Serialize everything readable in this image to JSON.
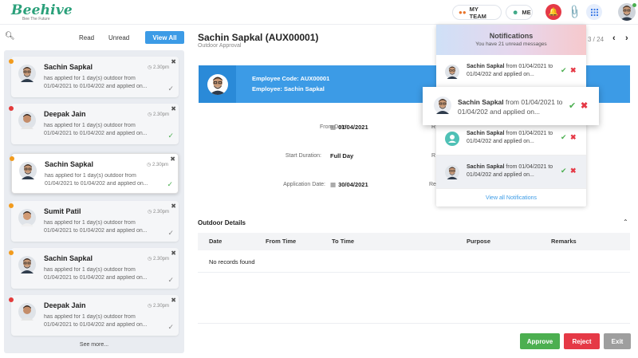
{
  "app": {
    "name": "Beehive",
    "tagline": "Bee The Future",
    "my_team_label": "MY TEAM",
    "me_label": "ME"
  },
  "list": {
    "filters": {
      "read": "Read",
      "unread": "Unread",
      "view_all": "View All"
    },
    "see_more": "See more...",
    "items": [
      {
        "name": "Sachin Sapkal",
        "time": "2.30pm",
        "desc1": "has applied for 1 day(s) outdoor from",
        "desc2": "01/04/2021 to 01/04/202 and applied on...",
        "status": "unread",
        "active": false
      },
      {
        "name": "Deepak Jain",
        "time": "2.30pm",
        "desc1": "has applied for 1 day(s) outdoor from",
        "desc2": "01/04/2021 to 01/04/202 and applied on...",
        "status": "rejected",
        "active": false
      },
      {
        "name": "Sachin Sapkal",
        "time": "2.30pm",
        "desc1": "has applied for 1 day(s) outdoor from",
        "desc2": "01/04/2021 to 01/04/202 and applied on...",
        "status": "unread",
        "active": true
      },
      {
        "name": "Sumit Patil",
        "time": "2.30pm",
        "desc1": "has applied for 1 day(s) outdoor from",
        "desc2": "01/04/2021 to 01/04/202 and applied on...",
        "status": "unread",
        "active": false
      },
      {
        "name": "Sachin Sapkal",
        "time": "2.30pm",
        "desc1": "has applied for 1 day(s) outdoor from",
        "desc2": "01/04/2021 to 01/04/202 and applied on...",
        "status": "unread",
        "active": false
      },
      {
        "name": "Deepak Jain",
        "time": "2.30pm",
        "desc1": "has applied for 1 day(s) outdoor from",
        "desc2": "01/04/2021 to 01/04/202 and applied on...",
        "status": "rejected",
        "active": false
      }
    ]
  },
  "detail": {
    "title": "Sachin Sapkal (AUX00001)",
    "subtitle": "Outdoor Approval",
    "pagination": "3 / 24",
    "employee_code": "Employee Code: AUX00001",
    "employee_name": "Employee: Sachin Sapkal",
    "fields": {
      "from_date_label": "From Date:",
      "from_date_value": "01/04/2021",
      "start_duration_label": "Start Duration:",
      "start_duration_value": "Full Day",
      "application_date_label": "Application Date:",
      "application_date_value": "30/04/2021"
    },
    "section_title": "Outdoor Details",
    "table_headers": [
      "Date",
      "From Time",
      "To Time",
      "Purpose",
      "Remarks"
    ],
    "empty_text": "No records found",
    "actions": {
      "approve": "Approve",
      "reject": "Reject",
      "exit": "Exit"
    }
  },
  "notifications": {
    "title": "Notifications",
    "subtitle": "You have 21 unread messages",
    "view_all": "View all Notifications",
    "items": [
      {
        "name": "Sachin Sapkal",
        "text": "from 01/04/2021 to 01/04/202 and applied on...",
        "avatar": "photo"
      },
      {
        "name": "Sachin Sapkal",
        "text": "from 01/04/2021 to 01/04/202 and applied on...",
        "avatar": "photo"
      },
      {
        "name": "Sachin Sapkal",
        "text": "from 01/04/2021 to 01/04/202 and applied on...",
        "avatar": "placeholder"
      },
      {
        "name": "Sachin Sapkal",
        "text": "from 01/04/2021 to 01/04/202 and applied on...",
        "avatar": "photo"
      }
    ]
  },
  "colors": {
    "brand_green": "#2aa07a",
    "accent_blue": "#3c9be6",
    "unread_dot": "#f29b1d",
    "rejected_dot": "#e33b3b",
    "approve": "#4caf50",
    "reject": "#e53946",
    "exit": "#9e9e9e"
  }
}
